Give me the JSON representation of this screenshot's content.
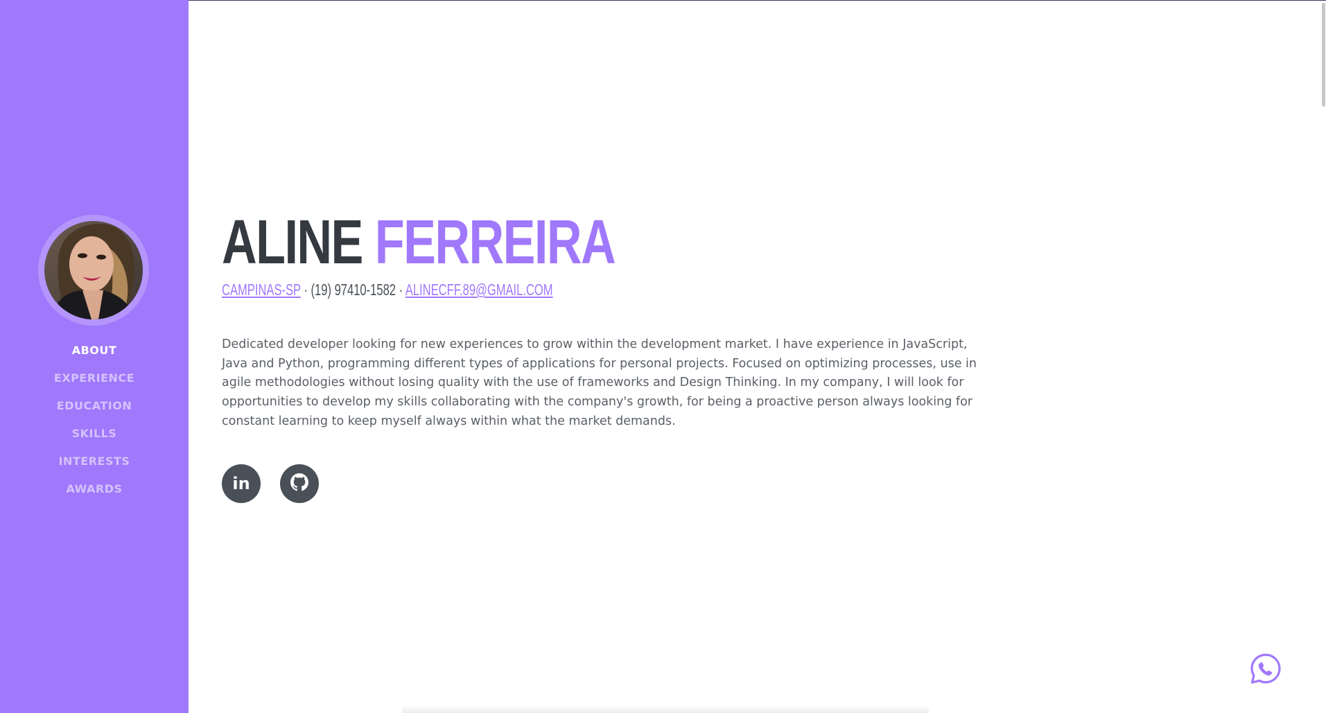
{
  "sidebar": {
    "avatar_alt": "profile photo",
    "nav": [
      {
        "label": "ABOUT",
        "active": true
      },
      {
        "label": "EXPERIENCE",
        "active": false
      },
      {
        "label": "EDUCATION",
        "active": false
      },
      {
        "label": "SKILLS",
        "active": false
      },
      {
        "label": "INTERESTS",
        "active": false
      },
      {
        "label": "AWARDS",
        "active": false
      }
    ]
  },
  "about": {
    "first_name": "ALINE",
    "last_name": "FERREIRA",
    "location": "CAMPINAS-SP",
    "separator": " · ",
    "phone": "(19) 97410-1582",
    "email": "ALINECFF.89@GMAIL.COM",
    "bio": "Dedicated developer looking for new experiences to grow within the development market. I have experience in JavaScript, Java and Python, programming different types of applications for personal projects. Focused on optimizing processes, use in agile methodologies without losing quality with the use of frameworks and Design Thinking. In my company, I will look for opportunities to develop my skills collaborating with the company's growth, for being a proactive person always looking for constant learning to keep myself always within what the market demands."
  },
  "social": {
    "linkedin_label": "in",
    "linkedin_icon": "linkedin-icon",
    "github_icon": "github-icon"
  },
  "floating": {
    "whatsapp_icon": "whatsapp-icon"
  },
  "colors": {
    "accent": "#a078fb",
    "dark": "#343a40",
    "social_bg": "#495057",
    "text": "#5a5f66"
  }
}
